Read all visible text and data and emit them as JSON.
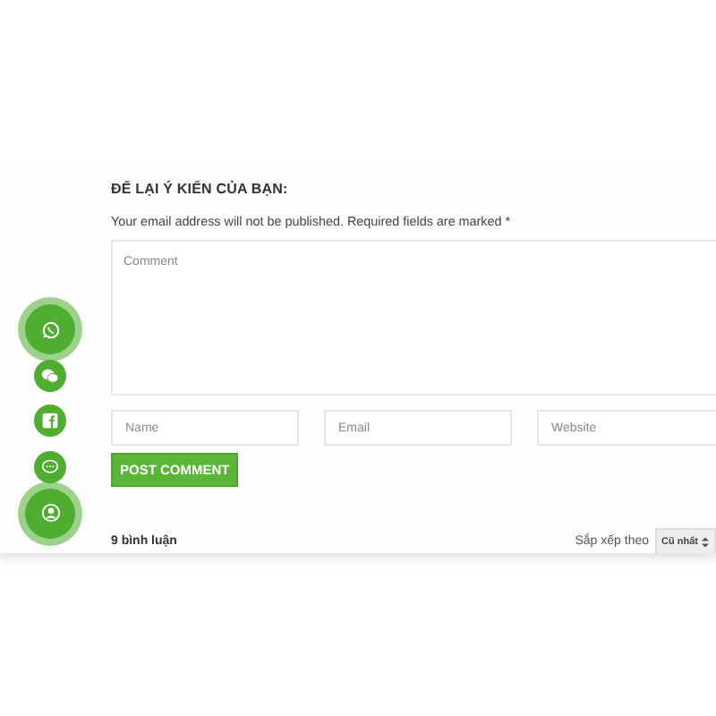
{
  "heading": "ĐỂ LẠI Ý KIẾN CỦA BẠN:",
  "notice": "Your email address will not be published. Required fields are marked *",
  "comment_field": {
    "placeholder": "Comment"
  },
  "fields": [
    {
      "placeholder": "Name"
    },
    {
      "placeholder": "Email"
    },
    {
      "placeholder": "Website"
    }
  ],
  "submit_button": "POST COMMENT",
  "comment_count": "9 bình luận",
  "sort": {
    "label": "Sắp xếp theo",
    "value": "Cũ nhất"
  },
  "floating_buttons": [
    {
      "kind": "whatsapp",
      "large": true
    },
    {
      "kind": "wechat",
      "large": false
    },
    {
      "kind": "facebook",
      "large": false
    },
    {
      "kind": "chat",
      "large": false
    },
    {
      "kind": "user",
      "large": true
    }
  ]
}
